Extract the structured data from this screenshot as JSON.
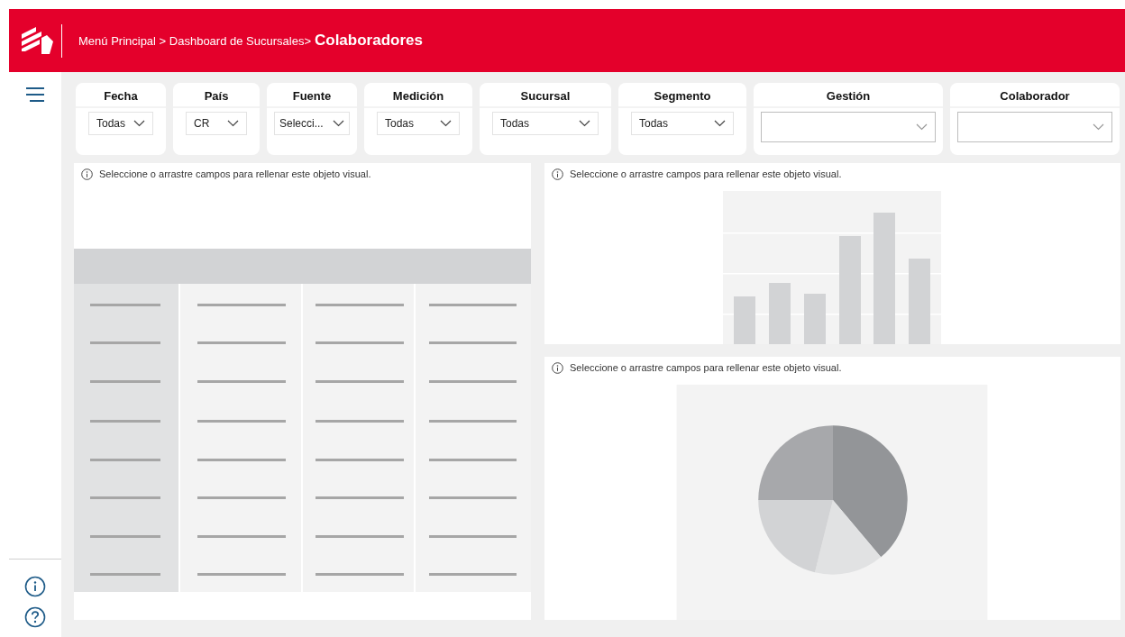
{
  "header": {
    "path": "Menú Principal > Dashboard de Sucursales>",
    "current": "Colaboradores"
  },
  "filters": [
    {
      "label": "Fecha",
      "value": "Todas"
    },
    {
      "label": "País",
      "value": "CR"
    },
    {
      "label": "Fuente",
      "value": "Selecci..."
    },
    {
      "label": "Medición",
      "value": "Todas"
    },
    {
      "label": "Sucursal",
      "value": "Todas"
    },
    {
      "label": "Segmento",
      "value": "Todas"
    },
    {
      "label": "Gestión"
    },
    {
      "label": "Colaborador"
    }
  ],
  "visuals": [
    {
      "kind": "table",
      "message": "Seleccione o arrastre campos para rellenar este objeto visual."
    },
    {
      "kind": "bar",
      "message": "Seleccione o arrastre campos para rellenar este objeto visual."
    },
    {
      "kind": "pie",
      "message": "Seleccione o arrastre campos para rellenar este objeto visual."
    }
  ]
}
